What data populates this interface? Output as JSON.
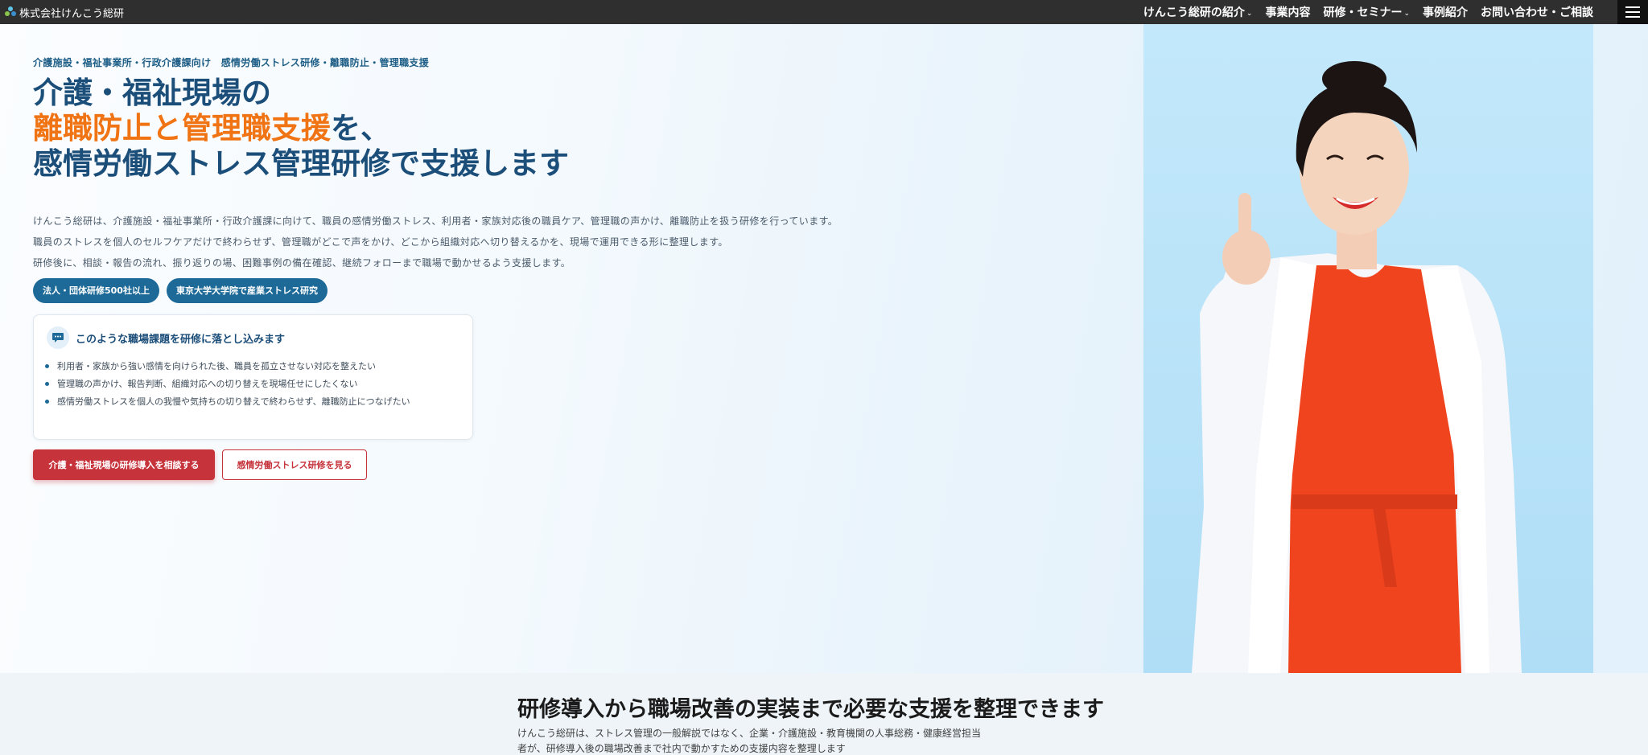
{
  "header": {
    "brand": "株式会社けんこう総研",
    "nav": [
      {
        "label": "けんこう総研の紹介",
        "dropdown": true
      },
      {
        "label": "事業内容",
        "dropdown": false
      },
      {
        "label": "研修・セミナー",
        "dropdown": true
      },
      {
        "label": "事例紹介",
        "dropdown": false
      },
      {
        "label": "お問い合わせ・ご相談",
        "dropdown": false
      }
    ],
    "menu_icon": "hamburger-icon"
  },
  "hero": {
    "eyebrow": "介護施設・福祉事業所・行政介護課向け　感情労働ストレス研修・離職防止・管理職支援",
    "headline": {
      "line1": "介護・福祉現場の",
      "line2_accent": "離職防止と管理職支援",
      "line2_rest": "を、",
      "line3": "感情労働ストレス管理研修で支援します"
    },
    "lead": [
      "けんこう総研は、介護施設・福祉事業所・行政介護課に向けて、職員の感情労働ストレス、利用者・家族対応後の職員ケア、管理職の声かけ、離職防止を扱う研修を行っています。",
      "職員のストレスを個人のセルフケアだけで終わらせず、管理職がどこで声をかけ、どこから組織対応へ切り替えるかを、現場で運用できる形に整理します。",
      "研修後に、相談・報告の流れ、振り返りの場、困難事例の備在確認、継続フォローまで職場で動かせるよう支援します。"
    ],
    "badges": [
      "法人・団体研修500社以上",
      "東京大学大学院で産業ストレス研究"
    ],
    "issues": {
      "title": "このような職場課題を研修に落とし込みます",
      "icon": "chat-bubble-icon",
      "items": [
        "利用者・家族から強い感情を向けられた後、職員を孤立させない対応を整えたい",
        "管理職の声かけ、報告判断、組織対応への切り替えを現場任せにしたくない",
        "感情労働ストレスを個人の我慢や気持ちの切り替えで終わらせず、離職防止につなげたい"
      ]
    },
    "cta_primary": "介護・福祉現場の研修導入を相談する",
    "cta_secondary": "感情労働ストレス研修を見る"
  },
  "services": {
    "title": "研修導入から職場改善の実装まで必要な支援を整理できます",
    "desc": "けんこう総研は、ストレス管理の一般解説ではなく、企業・介護施設・教育機関の人事総務・健康経営担当者が、研修導入後の職場改善まで社内で動かすための支援内容を整理します"
  },
  "colors": {
    "topbar": "#2f2f2f",
    "heading": "#1c4e7a",
    "accent": "#f07414",
    "badge": "#1d6a98",
    "cta": "#c6333b",
    "photo_bg": "#bfe6fa"
  }
}
